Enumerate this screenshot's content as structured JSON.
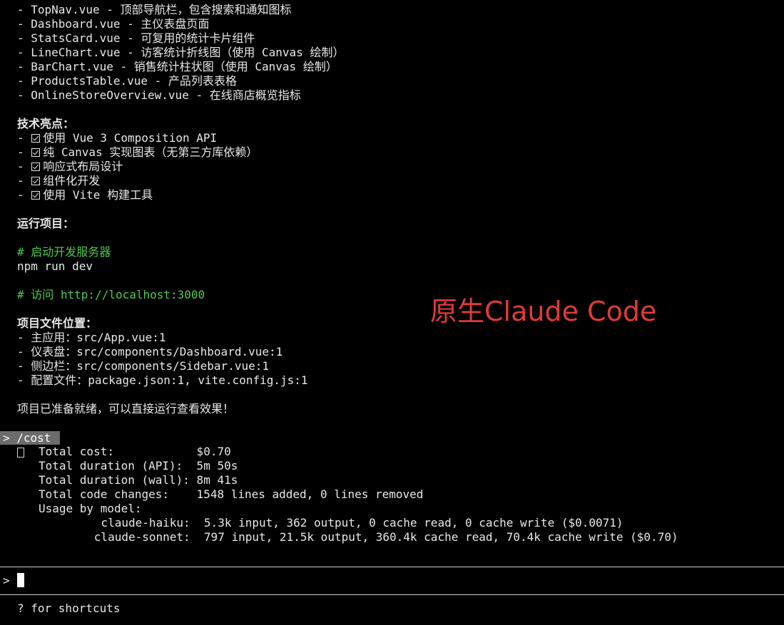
{
  "component_list": [
    "- TopNav.vue - 顶部导航栏，包含搜索和通知图标",
    "- Dashboard.vue - 主仪表盘页面",
    "- StatsCard.vue - 可复用的统计卡片组件",
    "- LineChart.vue - 访客统计折线图（使用 Canvas 绘制）",
    "- BarChart.vue - 销售统计柱状图（使用 Canvas 绘制）",
    "- ProductsTable.vue - 产品列表表格",
    "- OnlineStoreOverview.vue - 在线商店概览指标"
  ],
  "highlights": {
    "heading": "技术亮点：",
    "items": [
      "使用 Vue 3 Composition API",
      "纯 Canvas 实现图表（无第三方库依赖）",
      "响应式布局设计",
      "组件化开发",
      "使用 Vite 构建工具"
    ]
  },
  "run": {
    "heading": "运行项目：",
    "comment1": "# 启动开发服务器",
    "command": "npm run dev",
    "comment2": "# 访问 http://localhost:3000"
  },
  "files": {
    "heading": "项目文件位置：",
    "items": [
      "- 主应用：src/App.vue:1",
      "- 仪表盘：src/components/Dashboard.vue:1",
      "- 侧边栏：src/components/Sidebar.vue:1",
      "- 配置文件：package.json:1, vite.config.js:1"
    ]
  },
  "ready_message": "项目已准备就绪，可以直接运行查看效果！",
  "cost": {
    "command": "> /cost",
    "rows": [
      "Total cost:            $0.70",
      "Total duration (API):  5m 50s",
      "Total duration (wall): 8m 41s",
      "Total code changes:    1548 lines added, 0 lines removed",
      "Usage by model:"
    ],
    "models": [
      "       claude-haiku:  5.3k input, 362 output, 0 cache read, 0 cache write ($0.0071)",
      "      claude-sonnet:  797 input, 21.5k output, 360.4k cache read, 70.4k cache write ($0.70)"
    ]
  },
  "input": {
    "prompt": ">"
  },
  "footer": {
    "hint": "? for shortcuts"
  },
  "overlay": {
    "label": "原生Claude Code"
  },
  "colors": {
    "background": "#000000",
    "text": "#e8e8e8",
    "comment": "#4ec94e",
    "overlay": "#e03a3a",
    "highlight": "#6c6c6c"
  }
}
